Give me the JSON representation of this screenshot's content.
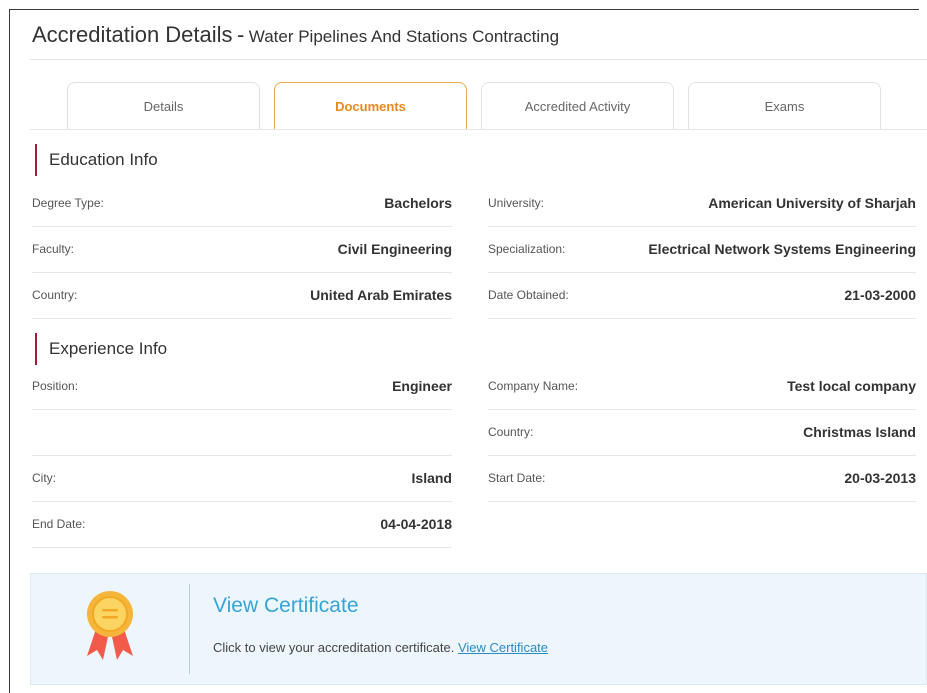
{
  "header": {
    "title": "Accreditation Details",
    "separator": "-",
    "subtitle": "Water Pipelines And Stations Contracting"
  },
  "tabs": [
    {
      "label": "Details",
      "active": false
    },
    {
      "label": "Documents",
      "active": true
    },
    {
      "label": "Accredited Activity",
      "active": false
    },
    {
      "label": "Exams",
      "active": false
    }
  ],
  "education": {
    "heading": "Education Info",
    "degree_type": {
      "label": "Degree Type:",
      "value": "Bachelors"
    },
    "university": {
      "label": "University:",
      "value": "American University of Sharjah"
    },
    "faculty": {
      "label": "Faculty:",
      "value": "Civil Engineering"
    },
    "specialization": {
      "label": "Specialization:",
      "value": "Electrical Network Systems Engineering"
    },
    "country": {
      "label": "Country:",
      "value": "United Arab Emirates"
    },
    "date_obtained": {
      "label": "Date Obtained:",
      "value": "21-03-2000"
    }
  },
  "experience": {
    "heading": "Experience Info",
    "position": {
      "label": "Position:",
      "value": "Engineer"
    },
    "company_name": {
      "label": "Company Name:",
      "value": "Test local company"
    },
    "country": {
      "label": "Country:",
      "value": "Christmas Island"
    },
    "city": {
      "label": "City:",
      "value": "Island"
    },
    "start_date": {
      "label": "Start Date:",
      "value": "20-03-2013"
    },
    "end_date": {
      "label": "End Date:",
      "value": "04-04-2018"
    }
  },
  "certificate": {
    "icon": "award-ribbon-icon",
    "title": "View Certificate",
    "description": "Click to view your accreditation certificate.",
    "link_label": "View Certificate"
  },
  "colors": {
    "accent_orange": "#e7891e",
    "section_bar": "#a3193a",
    "link_blue": "#35a4d8",
    "cert_background": "#eef6fd"
  }
}
